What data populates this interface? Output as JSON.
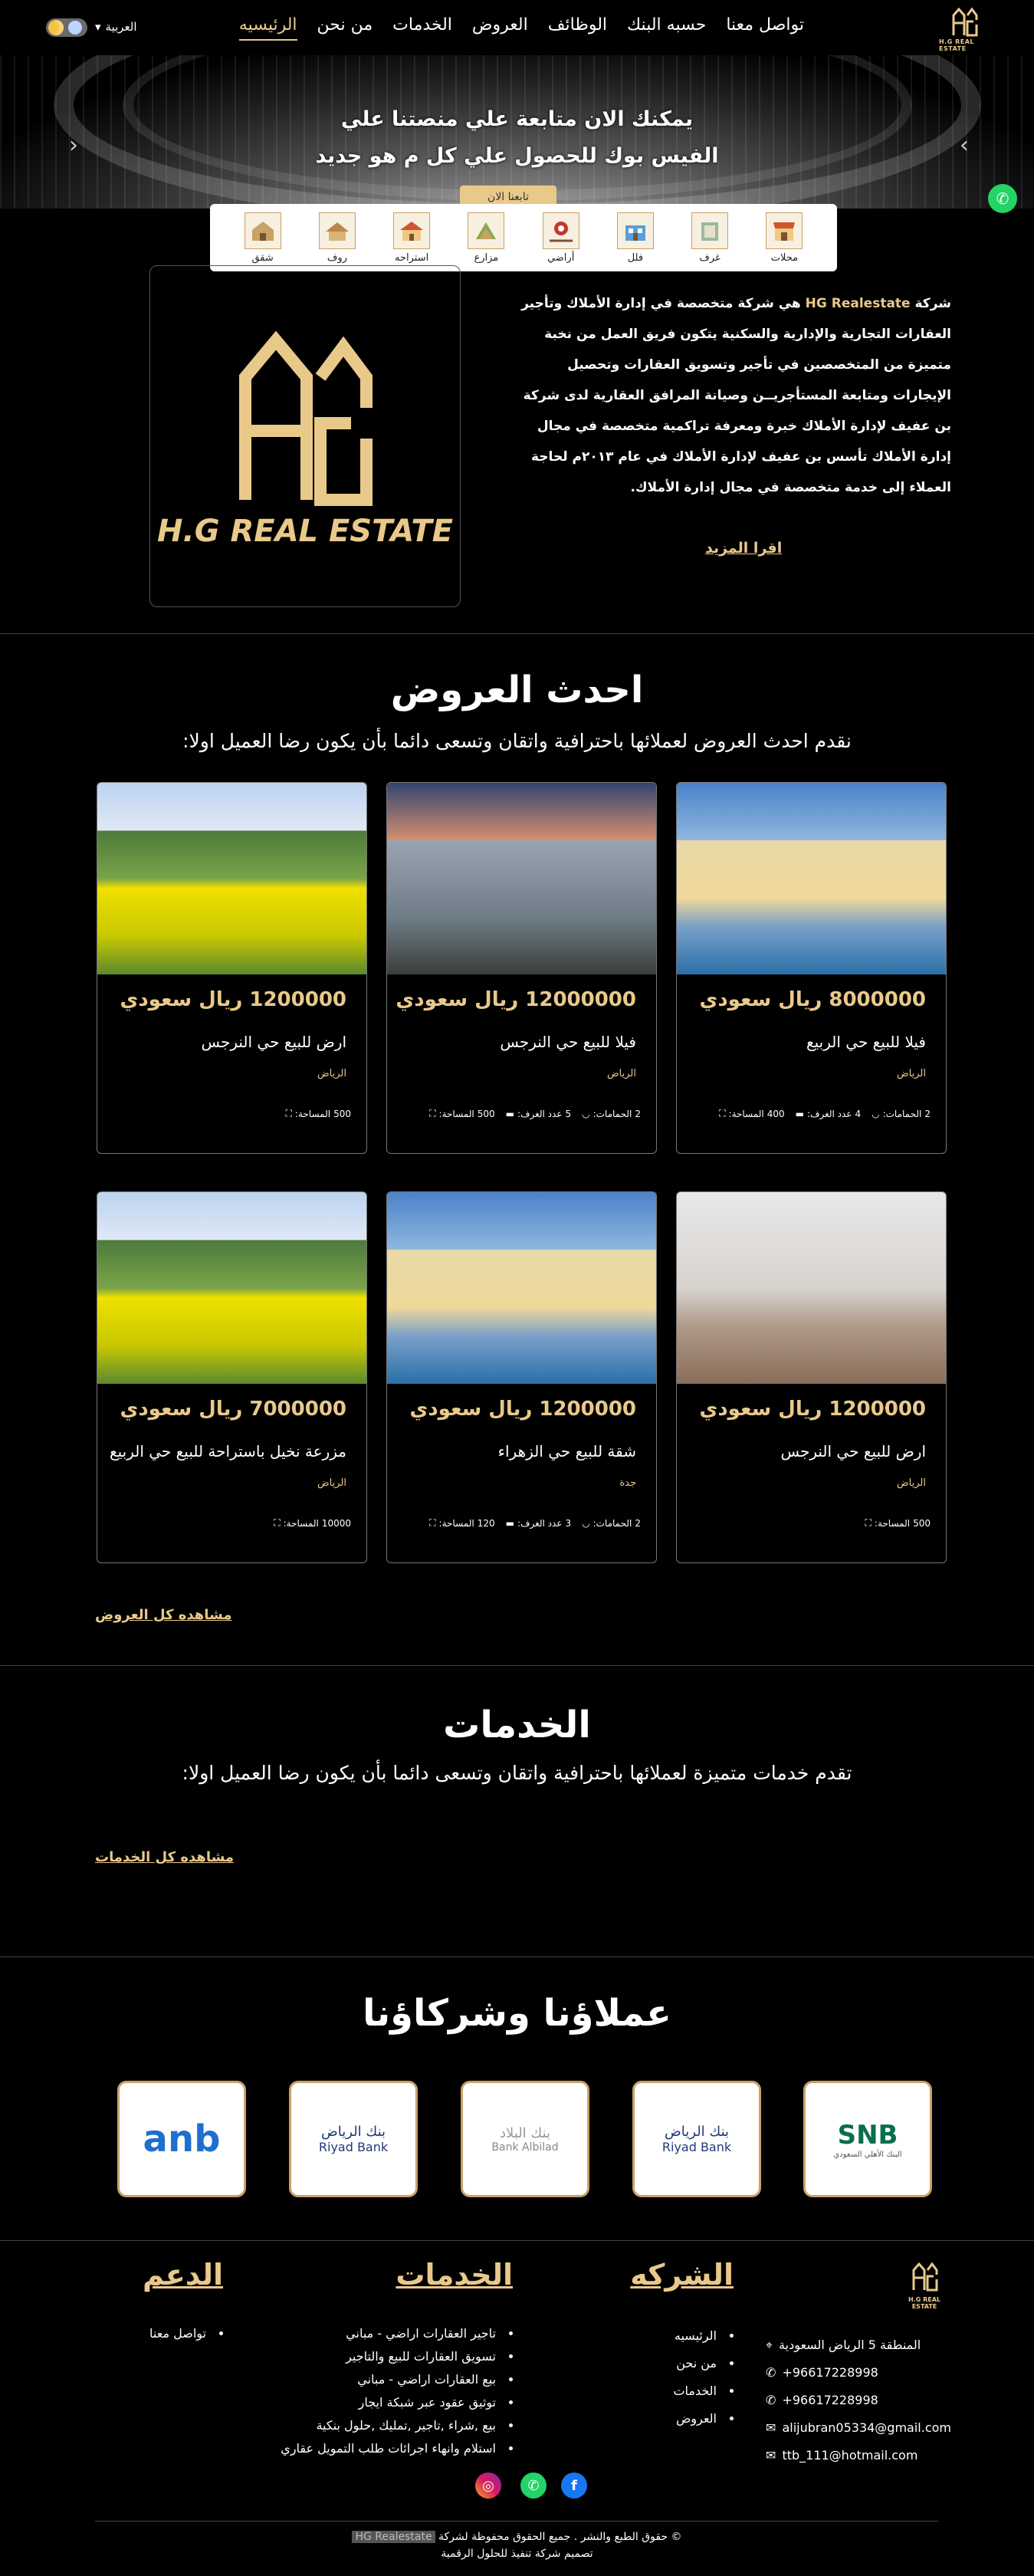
{
  "nav": {
    "logo_text": "H.G REAL ESTATE",
    "links": [
      "الرئيسيه",
      "من نحن",
      "الخدمات",
      "العروض",
      "الوظائف",
      "حسبه البنك",
      "تواصل معنا"
    ],
    "language": "العربية"
  },
  "hero": {
    "line1": "يمكنك الان متابعة علي منصتنا علي",
    "line2": "الفيس بوك للحصول علي كل م هو جديد",
    "button": "تابعنا الان"
  },
  "categories": [
    "شقق",
    "روف",
    "استراحه",
    "مزارع",
    "أراضي",
    "فلل",
    "غرف",
    "محلات"
  ],
  "about": {
    "logo_text": "H.G REAL ESTATE",
    "brand": "HG Realestate",
    "text_prefix": "شركة",
    "text": "هي شركة متخصصة في إدارة الأملاك وتأجير العقارات التجارية والإدارية والسكنية يتكون فريق العمل من نخبة متميزة من المتخصصين في تأجير وتسويق العقارات وتحصيل الإيجارات ومتابعة المستأجريــن وصيانة المرافق العقارية لدى شركة بن عفيف لإدارة الأملاك خبرة ومعرفة تراكمية متخصصة في مجال إدارة الأملاك تأسس بن عفيف لإدارة الأملاك في عام ٢٠١٣م لحاجة العملاء إلى خدمة متخصصة في مجال إدارة الأملاك.",
    "more": "اقرا المزيد"
  },
  "offers": {
    "title": "احدث العروض",
    "subtitle": "نقدم احدث العروض لعملائها باحترافية واتقان وتسعى دائما بأن يكون رضا العميل اولا:",
    "view_all": "مشاهده كل العروض",
    "area_label": "المساحة:",
    "rooms_label": "عدد الغرف:",
    "baths_label": "الحمامات:",
    "cards": [
      {
        "price": "8000000 ريال سعودي",
        "title": "فيلا للبيع حي الربيع",
        "city": "الرياض",
        "area": "400",
        "rooms": "4",
        "baths": "2",
        "img": "villa"
      },
      {
        "price": "12000000 ريال سعودي",
        "title": "فيلا للبيع حي النرجس",
        "city": "الرياض",
        "area": "500",
        "rooms": "5",
        "baths": "2",
        "img": "house"
      },
      {
        "price": "1200000 ريال سعودي",
        "title": "ارض للبيع حي النرجس",
        "city": "الرياض",
        "area": "500",
        "rooms": "",
        "baths": "",
        "img": "field"
      },
      {
        "price": "1200000 ريال سعودي",
        "title": "ارض للبيع حي النرجس",
        "city": "الرياض",
        "area": "500",
        "rooms": "",
        "baths": "",
        "img": "fog"
      },
      {
        "price": "1200000 ريال سعودي",
        "title": "شقة للبيع حي الزهراء",
        "city": "جدة",
        "area": "120",
        "rooms": "3",
        "baths": "2",
        "img": "villa"
      },
      {
        "price": "7000000 ريال سعودي",
        "title": "مزرعة نخيل باستراحة للبيع حي الربيع",
        "city": "الرياض",
        "area": "10000",
        "rooms": "",
        "baths": "",
        "img": "field"
      }
    ]
  },
  "services": {
    "title": "الخدمات",
    "subtitle": "تقدم خدمات متميزة لعملائها باحترافية واتقان وتسعى دائما بأن يكون رضا العميل اولا:",
    "view_all": "مشاهده كل الخدمات"
  },
  "partners": {
    "title": "عملاؤنا وشركاؤنا",
    "items": [
      "SNB",
      "بنك الرياض Riyad Bank",
      "بنك البلاد Bank Albilad",
      "بنك الرياض Riyad Bank",
      "anb"
    ]
  },
  "footer": {
    "logo_text": "H.G REAL ESTATE",
    "company_title": "الشركه",
    "company_links": [
      "الرئيسيه",
      "من نحن",
      "الخدمات",
      "العروض"
    ],
    "services_title": "الخدمات",
    "services_links": [
      "تاجير العقارات اراضي - مباني",
      "تسويق العقارات للبيع والتاجير",
      "بيع العقارات اراضي - مباني",
      "توثيق عقود عبر شبكة ايجار",
      "بيع ,شراء ,تاجير ,تمليك ,حلول بنكية",
      "استلام وانهاء اجرائات طلب التمويل عقاري"
    ],
    "support_title": "الدعم",
    "support_links": [
      "تواصل معنا"
    ],
    "address": "المنطقة 5 الرياض السعودية",
    "phone1": "96617228998+",
    "phone2": "96617228998+",
    "email1": "alijubran05334@gmail.com",
    "email2": "ttb_111@hotmail.com",
    "copyright": "© حقوق الطبع والنشر . جميع الحقوق محفوظة لشركة",
    "brand": "HG Realestate",
    "design": "تصميم شركة تنفيذ للحلول الرقمية"
  }
}
